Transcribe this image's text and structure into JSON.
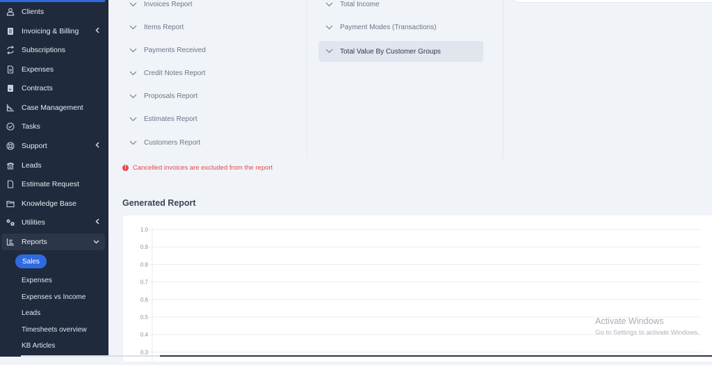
{
  "sidebar": {
    "items": [
      {
        "label": "Clients",
        "icon": "user-icon",
        "has_chevron": false
      },
      {
        "label": "Invoicing & Billing",
        "icon": "receipt-icon",
        "has_chevron": true
      },
      {
        "label": "Subscriptions",
        "icon": "repeat-icon",
        "has_chevron": false
      },
      {
        "label": "Expenses",
        "icon": "file-text-icon",
        "has_chevron": false
      },
      {
        "label": "Contracts",
        "icon": "contract-icon",
        "has_chevron": false
      },
      {
        "label": "Case Management",
        "icon": "chart-steps-icon",
        "has_chevron": false
      },
      {
        "label": "Tasks",
        "icon": "check-circle-icon",
        "has_chevron": false
      },
      {
        "label": "Support",
        "icon": "lifebuoy-icon",
        "has_chevron": true
      },
      {
        "label": "Leads",
        "icon": "phone-icon",
        "has_chevron": false
      },
      {
        "label": "Estimate Request",
        "icon": "file-icon",
        "has_chevron": false
      },
      {
        "label": "Knowledge Base",
        "icon": "folder-icon",
        "has_chevron": false
      },
      {
        "label": "Utilities",
        "icon": "gears-icon",
        "has_chevron": true
      },
      {
        "label": "Reports",
        "icon": "bar-chart-icon",
        "has_chevron": true,
        "expanded": true
      }
    ],
    "reports_sub": [
      "Sales",
      "Expenses",
      "Expenses vs Income",
      "Leads",
      "Timesheets overview",
      "KB Articles"
    ],
    "active_sub": "Sales"
  },
  "reports": {
    "column1": [
      "Invoices Report",
      "Items Report",
      "Payments Received",
      "Credit Notes Report",
      "Proposals Report",
      "Estimates Report",
      "Customers Report"
    ],
    "column2": [
      "Total Income",
      "Payment Modes (Transactions)",
      "Total Value By Customer Groups"
    ],
    "selected": "Total Value By Customer Groups"
  },
  "warning": "Cancelled invoices are excluded from the report",
  "generated_title": "Generated Report",
  "chart_data": {
    "type": "line",
    "title": "",
    "xlabel": "",
    "ylabel": "",
    "y_ticks": [
      "1.0",
      "0.9",
      "0.8",
      "0.7",
      "0.6",
      "0.5",
      "0.4",
      "0.3"
    ],
    "ylim": [
      0,
      1
    ],
    "series": [],
    "grid": true
  },
  "watermark": {
    "line1": "Activate Windows",
    "line2": "Go to Settings to activate Windows."
  },
  "colors": {
    "sidebar_bg": "#1f2a3c",
    "accent": "#2f6ae0",
    "warning": "#e5484d"
  }
}
